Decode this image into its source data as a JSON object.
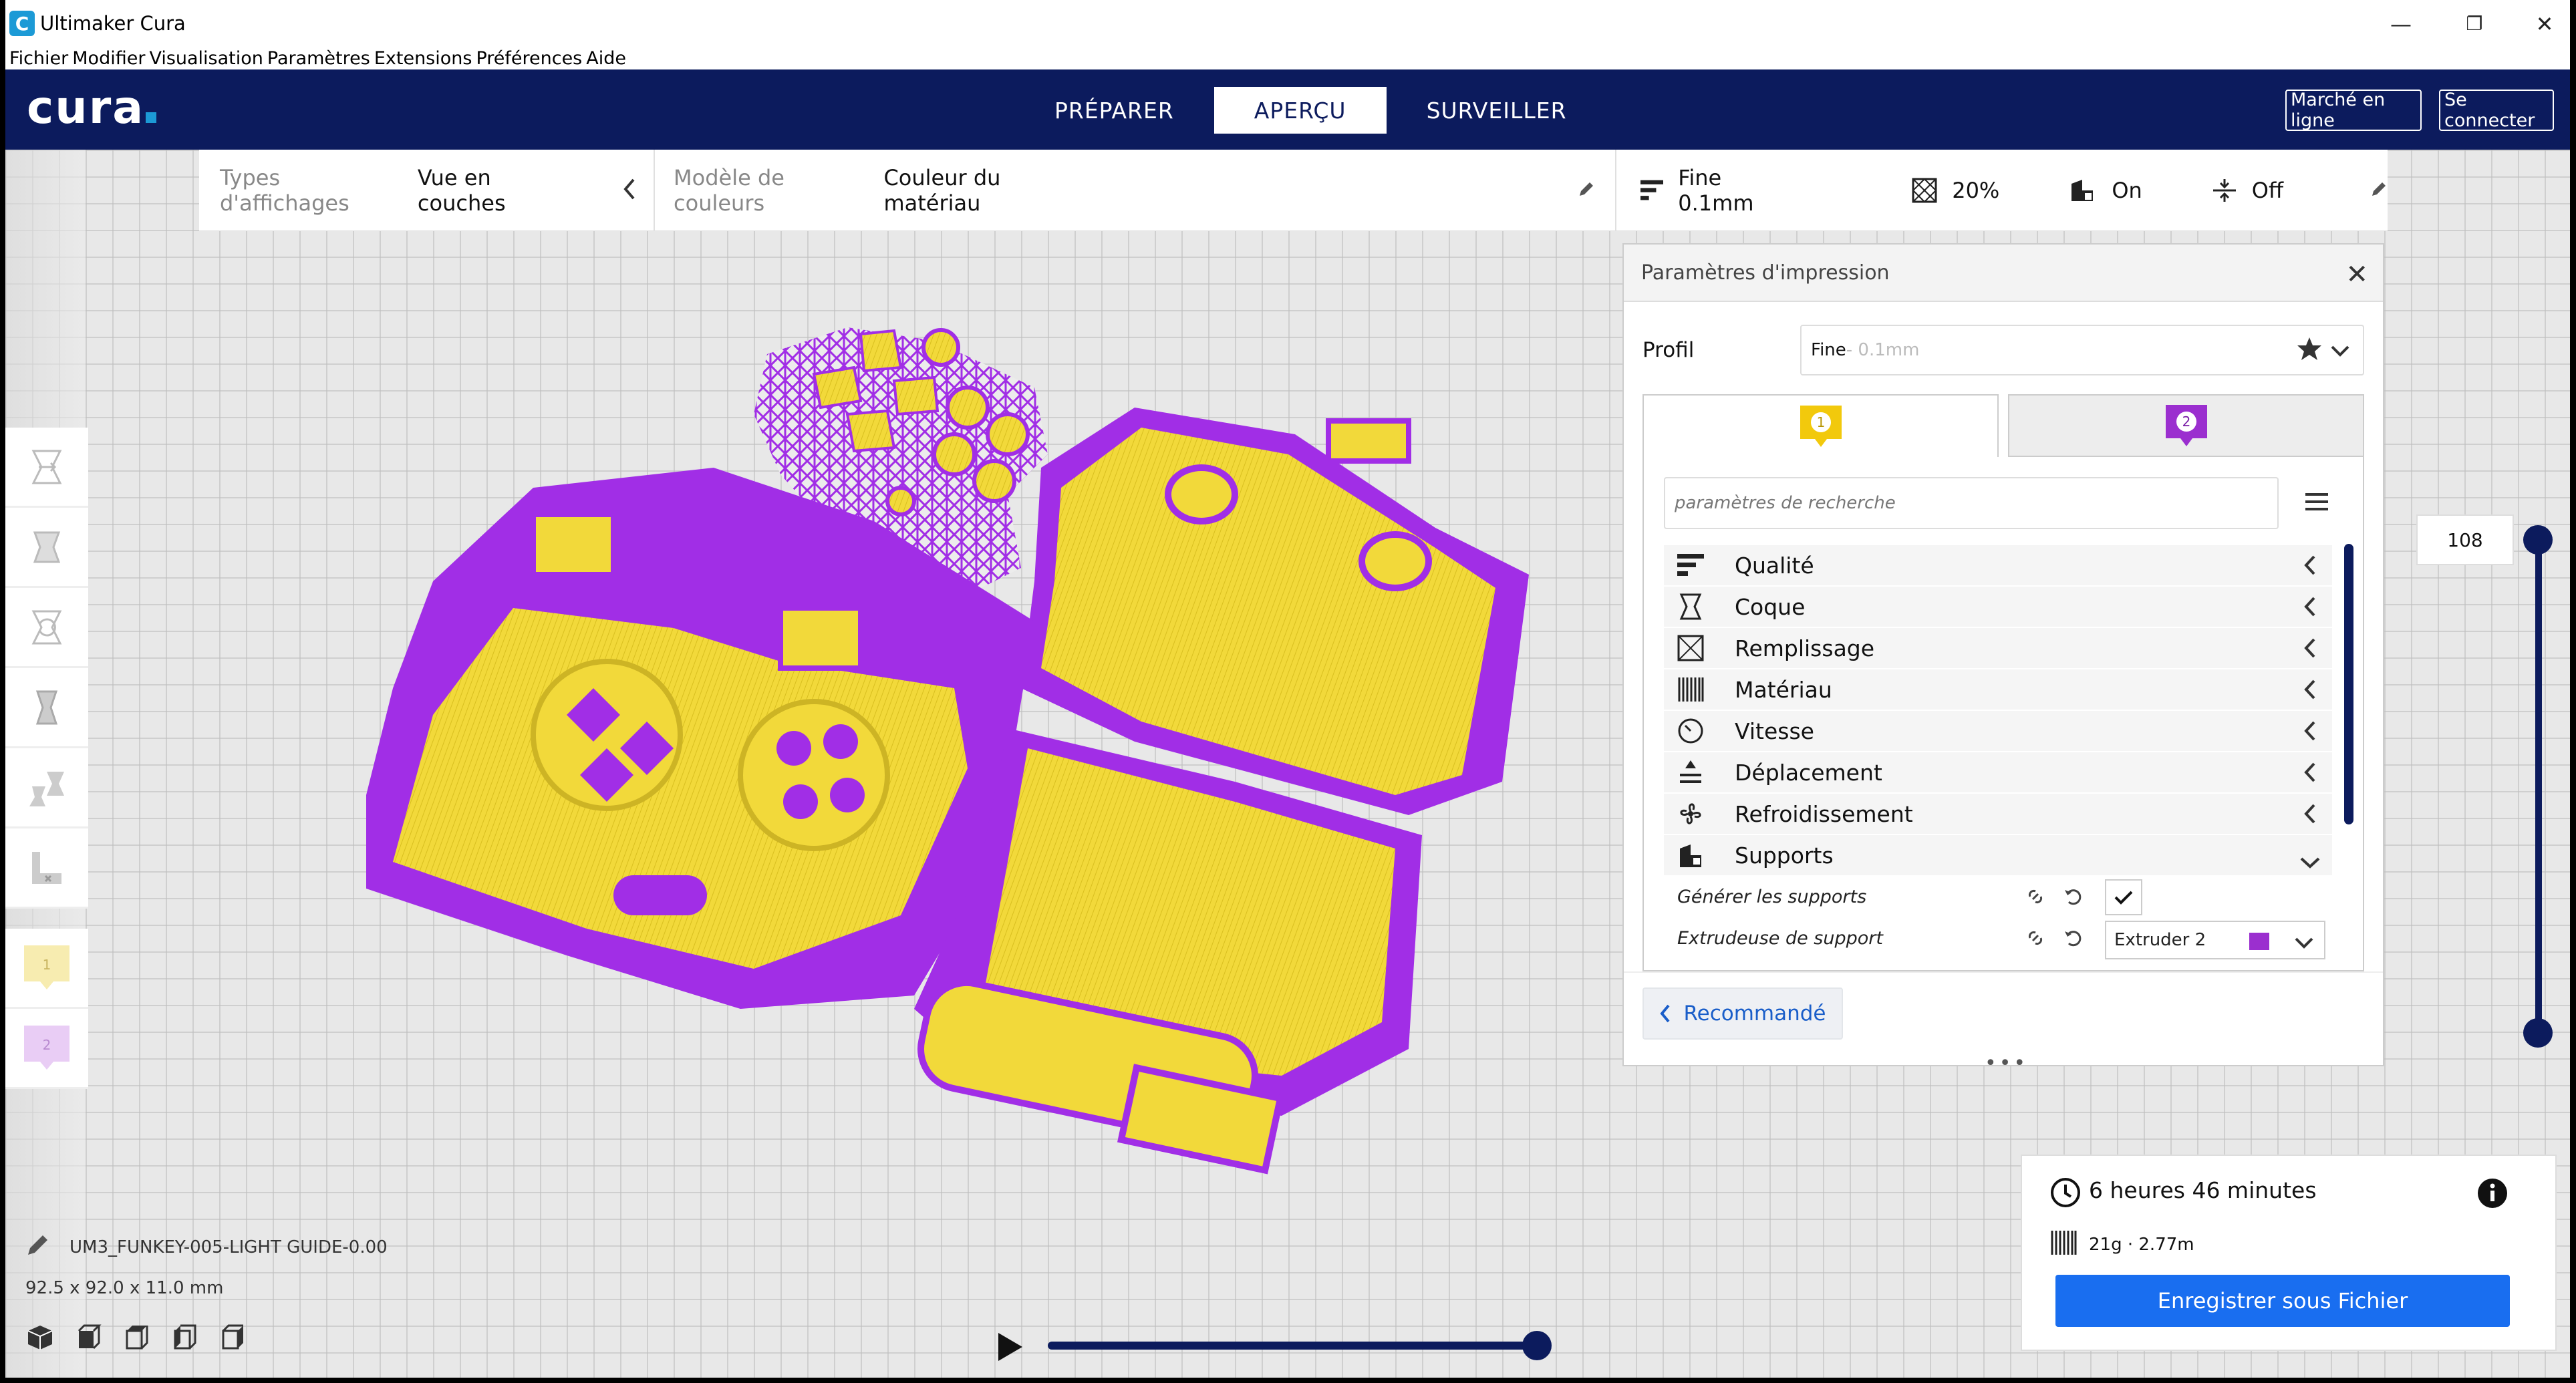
{
  "window": {
    "title": "Ultimaker Cura",
    "icon_letter": "C",
    "controls": [
      "—",
      "❐",
      "✕"
    ]
  },
  "menu": [
    "Fichier",
    "Modifier",
    "Visualisation",
    "Paramètres",
    "Extensions",
    "Préférences",
    "Aide"
  ],
  "header": {
    "logo": "cura",
    "stages": [
      {
        "label": "PRÉPARER",
        "active": false
      },
      {
        "label": "APERÇU",
        "active": true
      },
      {
        "label": "SURVEILLER",
        "active": false
      }
    ],
    "marketplace": "Marché en ligne",
    "signin": "Se connecter"
  },
  "viewbar": {
    "view_type_label": "Types d'affichages",
    "view_type_value": "Vue en couches",
    "color_scheme_label": "Modèle de couleurs",
    "color_scheme_value": "Couleur du matériau",
    "quality": "Fine 0.1mm",
    "infill": "20%",
    "support": "On",
    "adhesion": "Off"
  },
  "print_settings": {
    "title": "Paramètres d'impression",
    "profile_label": "Profil",
    "profile_name": "Fine",
    "profile_detail": " - 0.1mm",
    "extruder_tabs": [
      {
        "number": "1",
        "color": "#f2c90c"
      },
      {
        "number": "2",
        "color": "#9b2fcf"
      }
    ],
    "search_placeholder": "paramètres de recherche",
    "categories": [
      {
        "label": "Qualité",
        "icon": "quality-icon",
        "expanded": false
      },
      {
        "label": "Coque",
        "icon": "shell-icon",
        "expanded": false
      },
      {
        "label": "Remplissage",
        "icon": "infill-icon",
        "expanded": false
      },
      {
        "label": "Matériau",
        "icon": "material-icon",
        "expanded": false
      },
      {
        "label": "Vitesse",
        "icon": "speed-icon",
        "expanded": false
      },
      {
        "label": "Déplacement",
        "icon": "travel-icon",
        "expanded": false
      },
      {
        "label": "Refroidissement",
        "icon": "cooling-icon",
        "expanded": false
      },
      {
        "label": "Supports",
        "icon": "support-icon",
        "expanded": true
      }
    ],
    "settings": [
      {
        "label": "Générer les supports",
        "type": "checkbox",
        "checked": true
      },
      {
        "label": "Extrudeuse de support",
        "type": "select",
        "value": "Extruder 2"
      }
    ],
    "recommended": "Recommandé",
    "dots": "•••"
  },
  "left_toolbar": {
    "tools": [
      "move-tool-icon",
      "scale-tool-icon",
      "rotate-tool-icon",
      "mirror-tool-icon",
      "per-model-settings-icon",
      "support-blocker-icon"
    ],
    "extruders": [
      {
        "number": "1",
        "color": "#f7ecb0"
      },
      {
        "number": "2",
        "color": "#e9cdf5"
      }
    ]
  },
  "layer": {
    "value": "108"
  },
  "job": {
    "time": "6 heures 46 minutes",
    "material": "21g · 2.77m",
    "save": "Enregistrer sous Fichier"
  },
  "object": {
    "name": "UM3_FUNKEY-005-LIGHT GUIDE-0.00",
    "dims": "92.5 x 92.0 x 11.0 mm"
  },
  "colors": {
    "header": "#0c1b5d",
    "accent": "#196ef0",
    "yellow": "#f2d93a",
    "purple": "#a12ee6"
  }
}
